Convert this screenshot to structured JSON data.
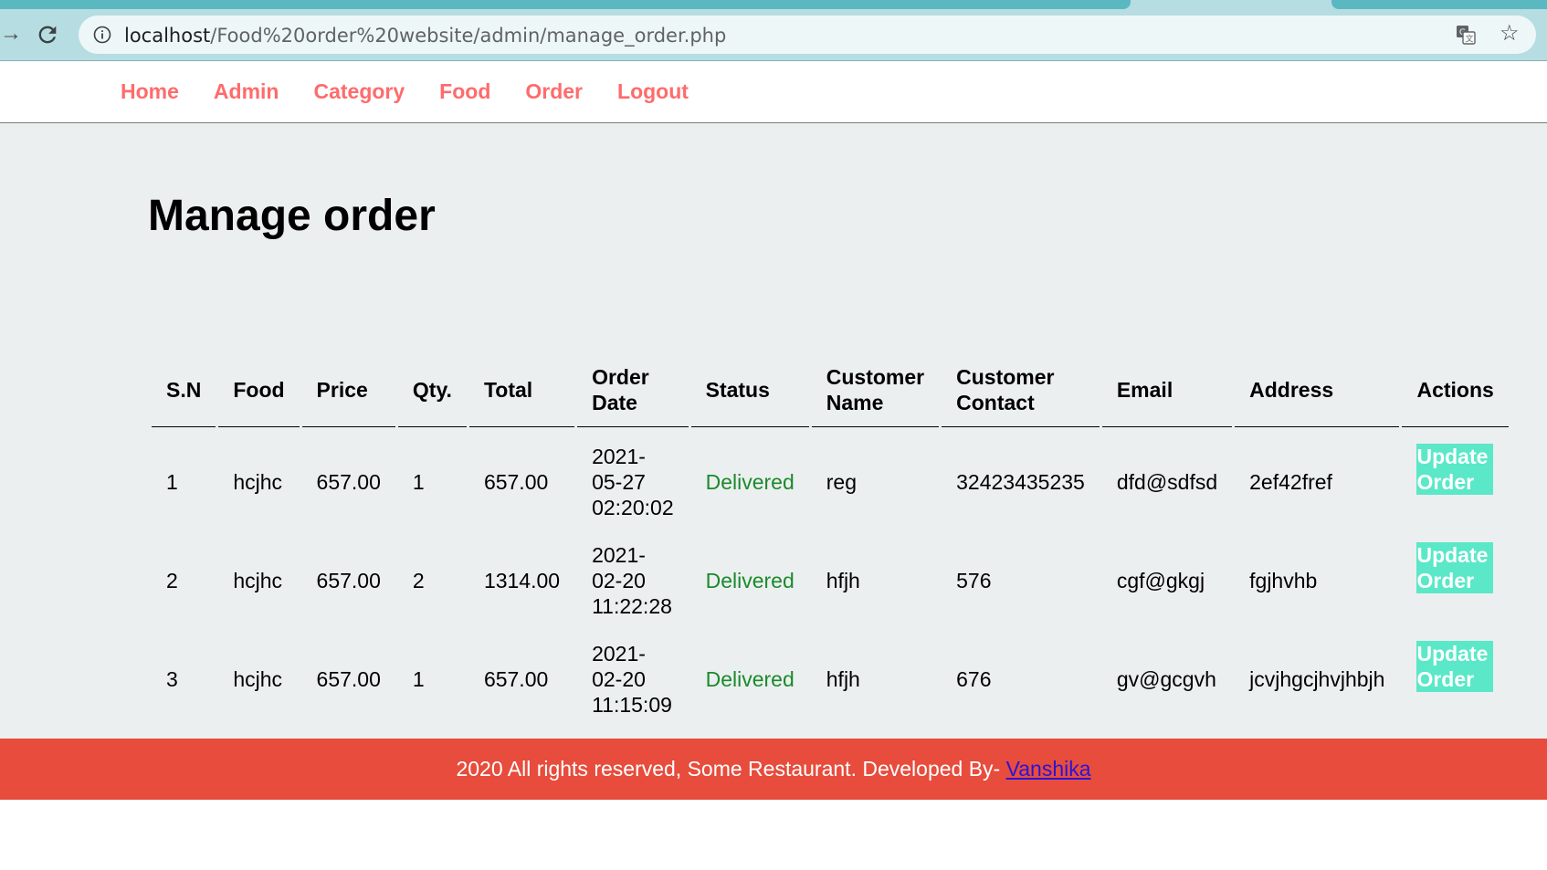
{
  "browser": {
    "url_host": "localhost",
    "url_path": "/Food%20order%20website/admin/manage_order.php"
  },
  "nav": {
    "items": [
      "Home",
      "Admin",
      "Category",
      "Food",
      "Order",
      "Logout"
    ]
  },
  "page": {
    "title": "Manage order"
  },
  "table": {
    "headers": [
      "S.N",
      "Food",
      "Price",
      "Qty.",
      "Total",
      "Order Date",
      "Status",
      "Customer Name",
      "Customer Contact",
      "Email",
      "Address",
      "Actions"
    ],
    "rows": [
      {
        "sn": "1",
        "food": "hcjhc",
        "price": "657.00",
        "qty": "1",
        "total": "657.00",
        "date": "2021-05-27",
        "time": "02:20:02",
        "status": "Delivered",
        "name": "reg",
        "contact": "32423435235",
        "email": "dfd@sdfsd",
        "address": "2ef42fref",
        "action": "Update Order"
      },
      {
        "sn": "2",
        "food": "hcjhc",
        "price": "657.00",
        "qty": "2",
        "total": "1314.00",
        "date": "2021-02-20",
        "time": "11:22:28",
        "status": "Delivered",
        "name": "hfjh",
        "contact": "576",
        "email": "cgf@gkgj",
        "address": "fgjhvhb",
        "action": "Update Order"
      },
      {
        "sn": "3",
        "food": "hcjhc",
        "price": "657.00",
        "qty": "1",
        "total": "657.00",
        "date": "2021-02-20",
        "time": "11:15:09",
        "status": "Delivered",
        "name": "hfjh",
        "contact": "676",
        "email": "gv@gcgvh",
        "address": "jcvjhgcjhvjhbjh",
        "action": "Update Order"
      }
    ]
  },
  "footer": {
    "text": "2020 All rights reserved, Some Restaurant. Developed By- ",
    "link": "Vanshika"
  },
  "colors": {
    "nav_link": "#ff6b6b",
    "footer_bg": "#e74c3c",
    "status_delivered": "#1b8a2b",
    "update_button_bg": "#5ae8c8",
    "main_bg": "#eceff0"
  },
  "icons": [
    "back-arrow-icon",
    "reload-icon",
    "info-icon",
    "translate-icon",
    "star-icon"
  ]
}
